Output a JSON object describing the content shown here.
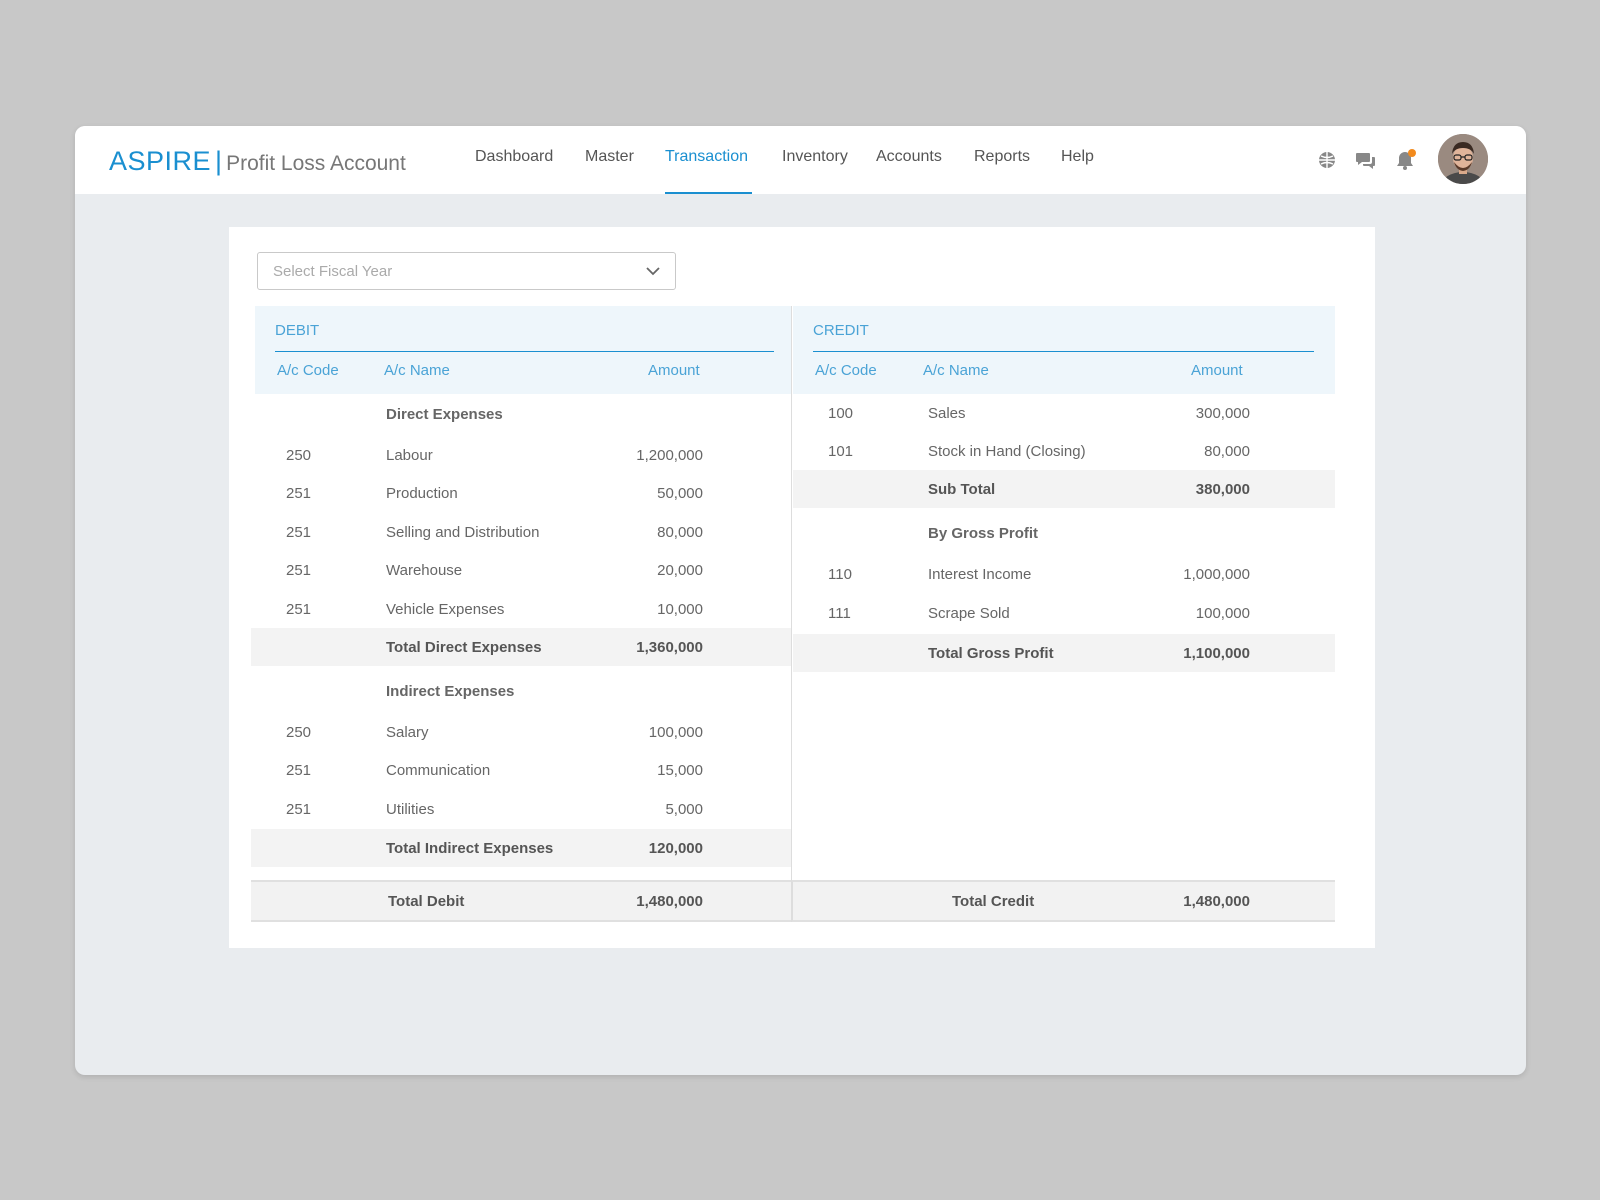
{
  "brand": {
    "logo": "ASPIRE",
    "separator": "|",
    "title": "Profit Loss Account"
  },
  "nav": [
    {
      "label": "Dashboard",
      "active": false
    },
    {
      "label": "Master",
      "active": false
    },
    {
      "label": "Transaction",
      "active": true
    },
    {
      "label": "Inventory",
      "active": false
    },
    {
      "label": "Accounts",
      "active": false
    },
    {
      "label": "Reports",
      "active": false
    },
    {
      "label": "Help",
      "active": false
    }
  ],
  "header_icons": [
    "globe-icon",
    "chat-icon",
    "bell-icon",
    "avatar"
  ],
  "colors": {
    "accent": "#1a8fd0",
    "notification": "#f28a1d",
    "header_bg": "#eef6fb",
    "total_bg": "#f3f3f3"
  },
  "fiscal_year": {
    "placeholder": "Select Fiscal Year"
  },
  "debit": {
    "title": "DEBIT",
    "columns": {
      "code": "A/c Code",
      "name": "A/c Name",
      "amount": "Amount"
    },
    "direct": {
      "heading": "Direct Expenses",
      "rows": [
        {
          "code": "250",
          "name": "Labour",
          "amount": "1,200,000"
        },
        {
          "code": "251",
          "name": "Production",
          "amount": "50,000"
        },
        {
          "code": "251",
          "name": "Selling and Distribution",
          "amount": "80,000"
        },
        {
          "code": "251",
          "name": "Warehouse",
          "amount": "20,000"
        },
        {
          "code": "251",
          "name": "Vehicle Expenses",
          "amount": "10,000"
        }
      ],
      "total_label": "Total Direct Expenses",
      "total_amount": "1,360,000"
    },
    "indirect": {
      "heading": "Indirect Expenses",
      "rows": [
        {
          "code": "250",
          "name": "Salary",
          "amount": "100,000"
        },
        {
          "code": "251",
          "name": "Communication",
          "amount": "15,000"
        },
        {
          "code": "251",
          "name": "Utilities",
          "amount": "5,000"
        }
      ],
      "total_label": "Total Indirect Expenses",
      "total_amount": "120,000"
    },
    "grand_label": "Total Debit",
    "grand_amount": "1,480,000"
  },
  "credit": {
    "title": "CREDIT",
    "columns": {
      "code": "A/c Code",
      "name": "A/c Name",
      "amount": "Amount"
    },
    "sales": {
      "rows": [
        {
          "code": "100",
          "name": "Sales",
          "amount": "300,000"
        },
        {
          "code": "101",
          "name": "Stock in Hand (Closing)",
          "amount": "80,000"
        }
      ],
      "total_label": "Sub Total",
      "total_amount": "380,000"
    },
    "gross": {
      "heading": "By Gross Profit",
      "rows": [
        {
          "code": "110",
          "name": "Interest Income",
          "amount": "1,000,000"
        },
        {
          "code": "111",
          "name": "Scrape Sold",
          "amount": "100,000"
        }
      ],
      "total_label": "Total Gross Profit",
      "total_amount": "1,100,000"
    },
    "grand_label": "Total Credit",
    "grand_amount": "1,480,000"
  }
}
